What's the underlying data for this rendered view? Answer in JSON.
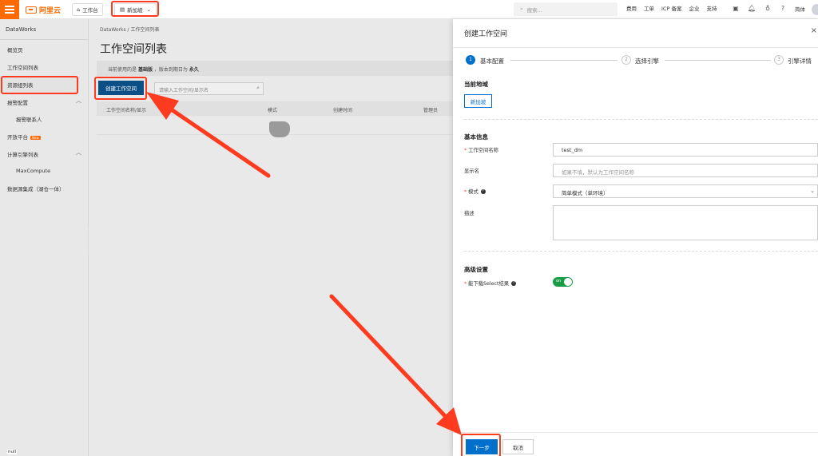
{
  "topbar": {
    "logo_text": "阿里云",
    "home_label": "工作台",
    "region_label": "新加坡",
    "search_placeholder": "搜索...",
    "nav": [
      "费用",
      "工单",
      "ICP 备案",
      "企业",
      "支持"
    ],
    "lang_label": "简体"
  },
  "sidebar": {
    "title": "DataWorks",
    "items": [
      {
        "label": "概览页"
      },
      {
        "label": "工作空间列表",
        "active": true
      },
      {
        "label": "资源组列表"
      },
      {
        "label": "报警配置",
        "expanded": true
      },
      {
        "label": "报警联系人"
      },
      {
        "label": "开放平台",
        "badge": "New"
      },
      {
        "label": "计算引擎列表",
        "expanded": true
      },
      {
        "label": "MaxCompute"
      },
      {
        "label": "数据源集成（湖仓一体）"
      }
    ],
    "footer_text": "null"
  },
  "main": {
    "breadcrumb": "DataWorks  /  工作空间列表",
    "title": "工作空间列表",
    "notice": {
      "prefix": "当前使用的是",
      "edition": "基础版",
      "middle": "，版本到期日为",
      "expiry": "永久"
    },
    "create_button": "创建工作空间",
    "search_placeholder": "请输入工作空间/显示名",
    "table_headers": [
      "工作空间名称/显示",
      "模式",
      "创建时间",
      "管理员"
    ]
  },
  "panel": {
    "title": "创建工作空间",
    "steps": [
      {
        "num": "1",
        "label": "基本配置",
        "active": true
      },
      {
        "num": "2",
        "label": "选择引擎",
        "active": false
      },
      {
        "num": "3",
        "label": "引擎详情",
        "active": false
      }
    ],
    "region_section": "当前地域",
    "region_value": "新加坡",
    "basic_section": "基本信息",
    "fields": {
      "name_label": "工作空间名称",
      "name_value": "test_dm",
      "display_label": "显示名",
      "display_placeholder": "如果不填，默认为工作空间名称",
      "mode_label": "模式",
      "mode_value": "简单模式（单环境）",
      "desc_label": "描述"
    },
    "advanced_section": "高级设置",
    "download_label": "能下载Select结果",
    "toggle_text": "on",
    "toggle_on": true,
    "next_button": "下一步",
    "cancel_button": "取消"
  },
  "colors": {
    "brand": "#ff6a00",
    "primary": "#0070cc",
    "annotation": "#ff3b1f",
    "toggle_on": "#1a9c46"
  }
}
